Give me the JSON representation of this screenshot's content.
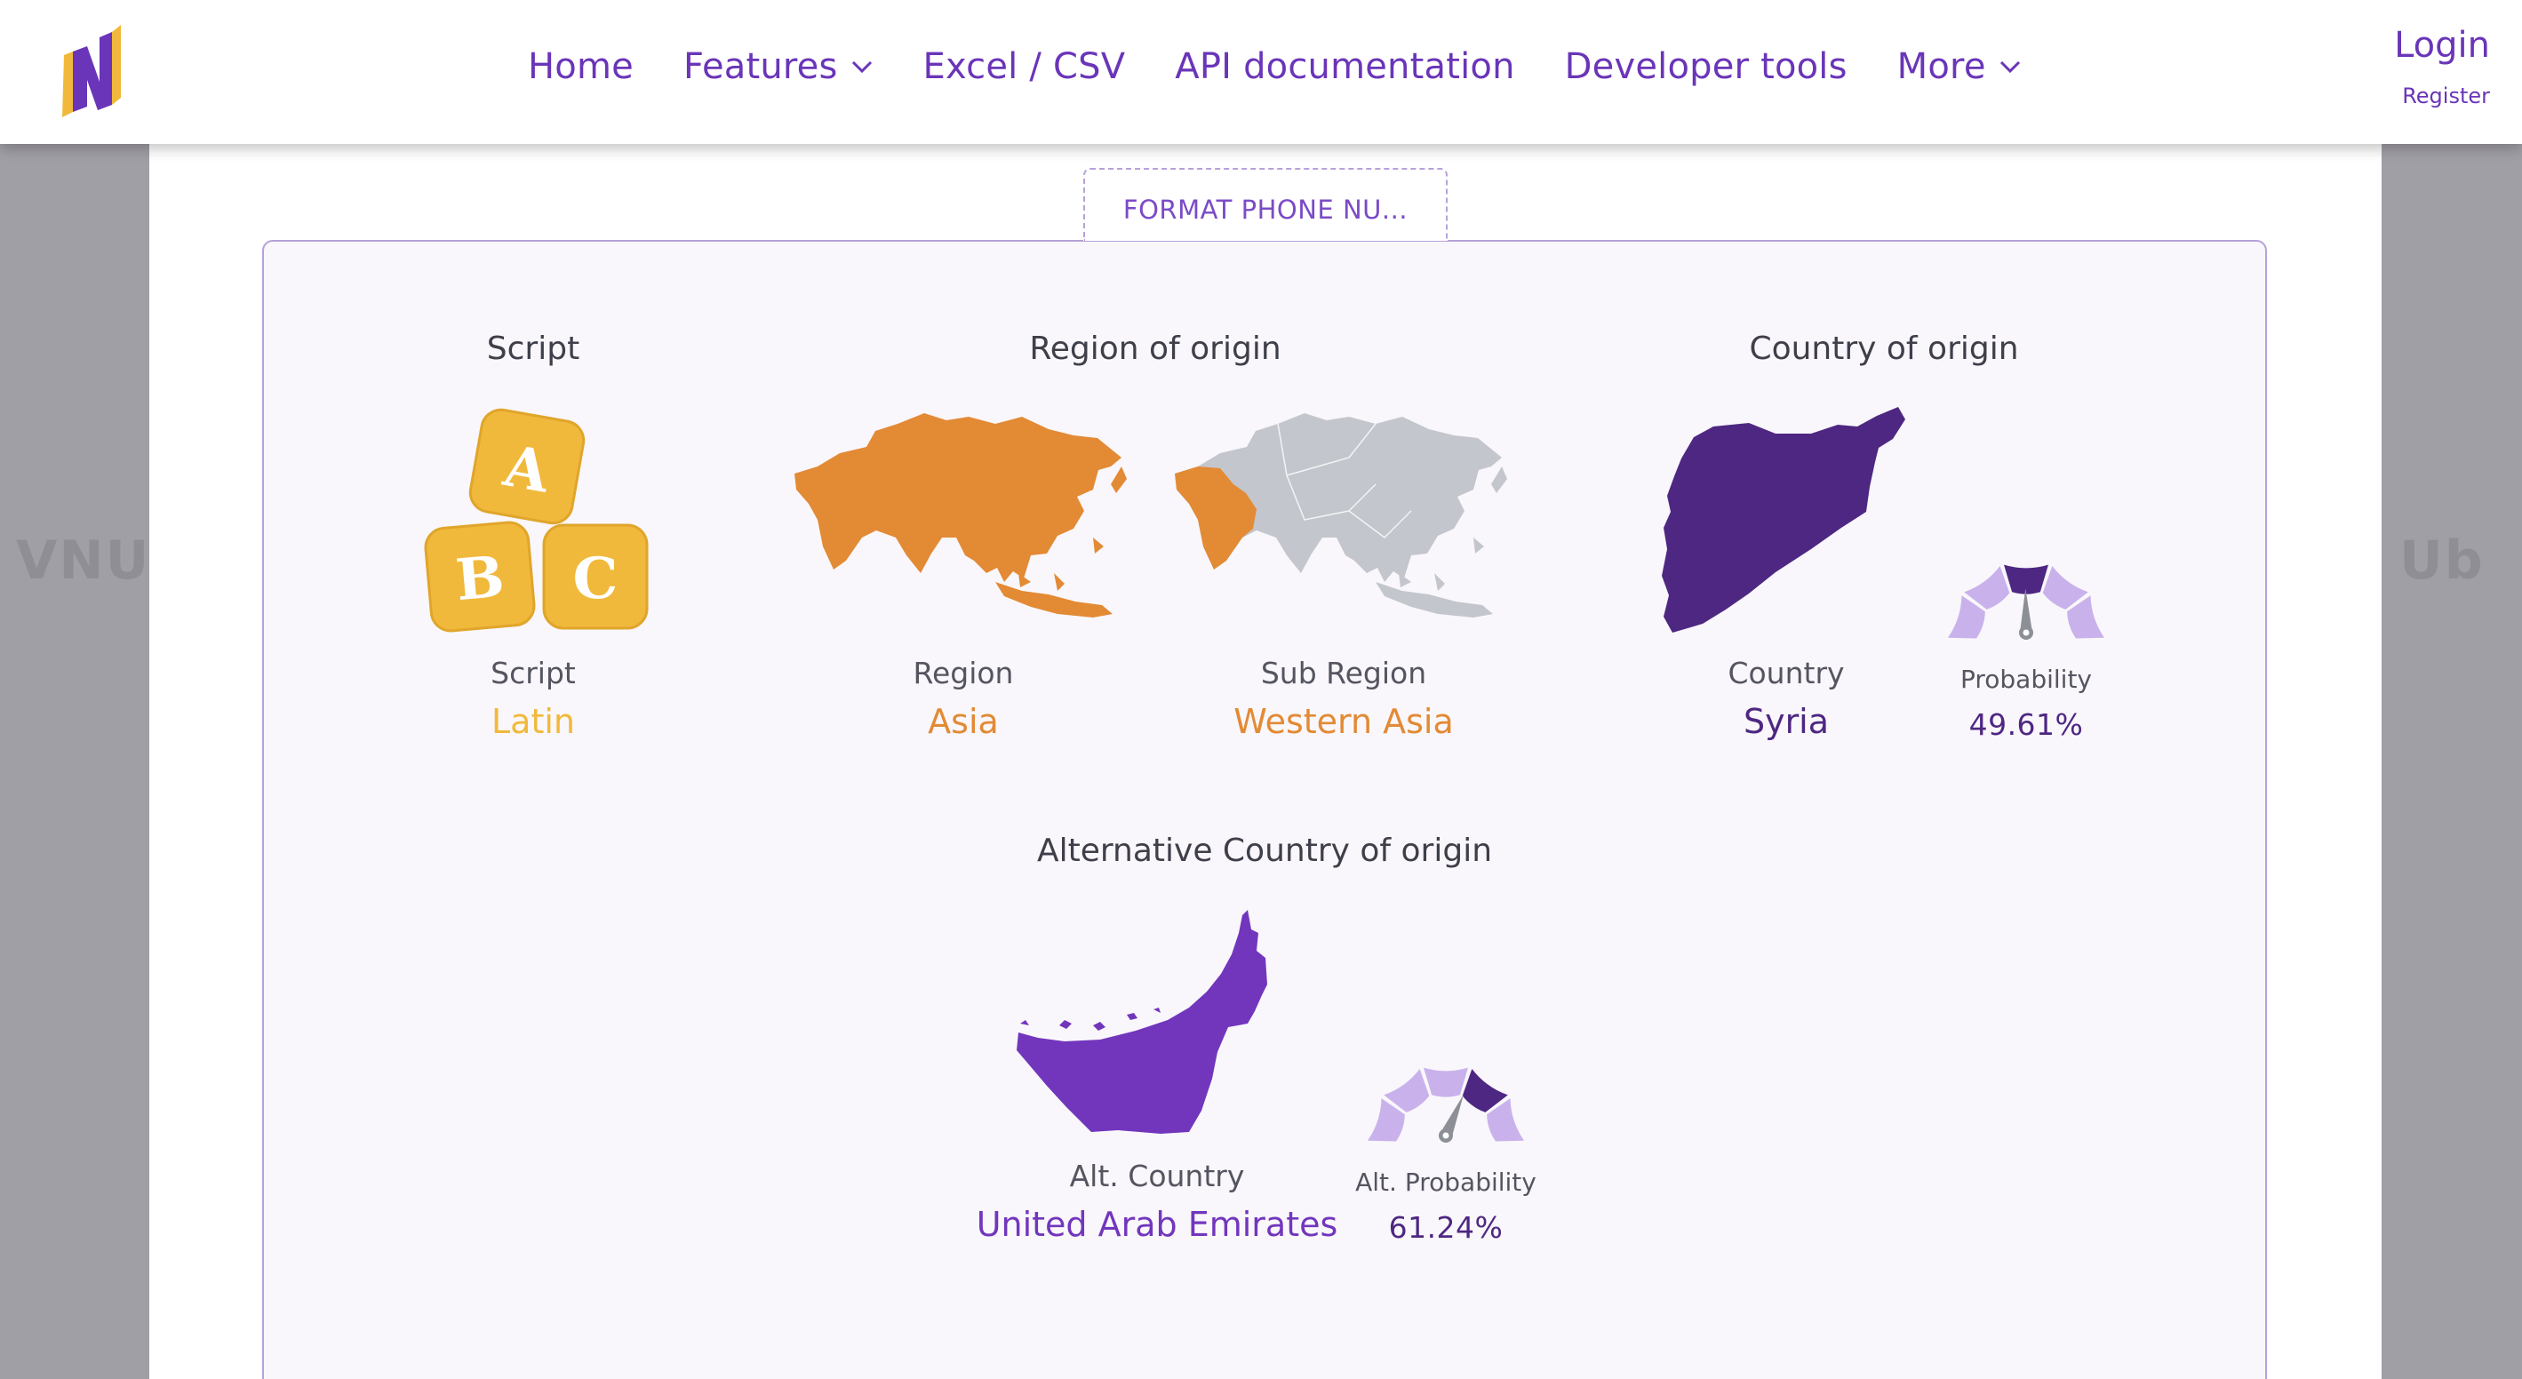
{
  "header": {
    "nav": [
      {
        "label": "Home",
        "has_dropdown": false
      },
      {
        "label": "Features",
        "has_dropdown": true
      },
      {
        "label": "Excel / CSV",
        "has_dropdown": false
      },
      {
        "label": "API documentation",
        "has_dropdown": false
      },
      {
        "label": "Developer tools",
        "has_dropdown": false
      },
      {
        "label": "More",
        "has_dropdown": true
      }
    ],
    "login_label": "Login",
    "register_label": "Register"
  },
  "background": {
    "watermark_left": "VNU",
    "watermark_right": "Ub"
  },
  "tab": {
    "label": "FORMAT PHONE NU..."
  },
  "script": {
    "heading": "Script",
    "blocks": [
      "A",
      "B",
      "C"
    ],
    "sub_label": "Script",
    "value": "Latin"
  },
  "region": {
    "heading": "Region of origin",
    "region_label": "Region",
    "region_value": "Asia",
    "subregion_label": "Sub Region",
    "subregion_value": "Western Asia"
  },
  "country": {
    "heading": "Country of origin",
    "country_label": "Country",
    "country_value": "Syria",
    "probability_label": "Probability",
    "probability_value": "49.61%",
    "probability": 0.4961
  },
  "alt_country": {
    "heading": "Alternative Country of origin",
    "country_label": "Alt. Country",
    "country_value": "United Arab Emirates",
    "probability_label": "Alt. Probability",
    "probability_value": "61.24%",
    "probability": 0.6124
  },
  "colors": {
    "brand_purple": "#6a35b8",
    "script_yellow": "#f1b93b",
    "region_orange": "#e38a35",
    "map_gray": "#c3c6cc",
    "syria_purple": "#4e2782",
    "uae_purple": "#7236bd",
    "gauge_light": "#c9b2ec",
    "gauge_active_dark": "#4e2782",
    "gauge_needle": "#8d8f97"
  }
}
